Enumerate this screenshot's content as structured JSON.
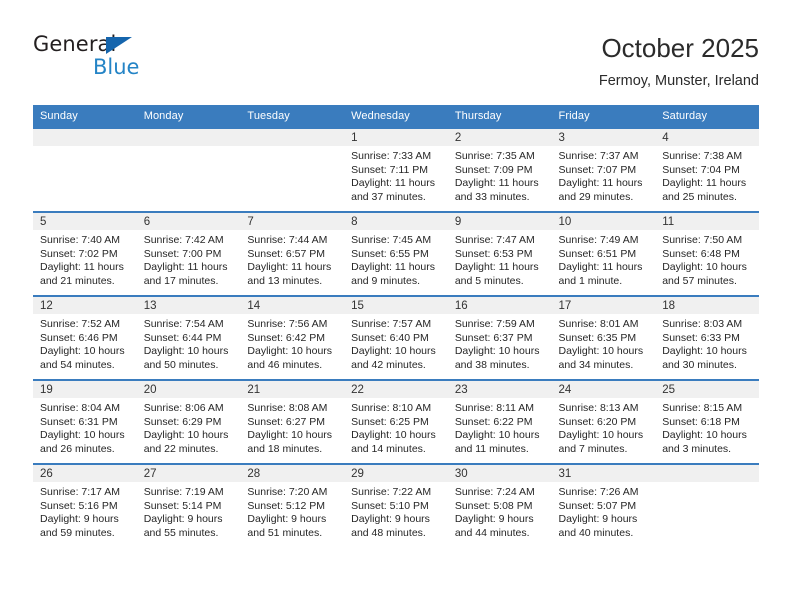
{
  "brand": {
    "name_part1": "General",
    "name_part2": "Blue",
    "triangle_color": "#1565ad",
    "blue_color": "#2484c6"
  },
  "header": {
    "title": "October 2025",
    "location": "Fermoy, Munster, Ireland"
  },
  "theme": {
    "header_blue": "#3a7cbe",
    "daynum_bg": "#f0f0f0",
    "cell_bg": "#ffffff"
  },
  "weekday_headers": [
    "Sunday",
    "Monday",
    "Tuesday",
    "Wednesday",
    "Thursday",
    "Friday",
    "Saturday"
  ],
  "weeks": [
    [
      {
        "day": "",
        "sunrise": "",
        "sunset": "",
        "daylight1": "",
        "daylight2": ""
      },
      {
        "day": "",
        "sunrise": "",
        "sunset": "",
        "daylight1": "",
        "daylight2": ""
      },
      {
        "day": "",
        "sunrise": "",
        "sunset": "",
        "daylight1": "",
        "daylight2": ""
      },
      {
        "day": "1",
        "sunrise": "Sunrise: 7:33 AM",
        "sunset": "Sunset: 7:11 PM",
        "daylight1": "Daylight: 11 hours",
        "daylight2": "and 37 minutes."
      },
      {
        "day": "2",
        "sunrise": "Sunrise: 7:35 AM",
        "sunset": "Sunset: 7:09 PM",
        "daylight1": "Daylight: 11 hours",
        "daylight2": "and 33 minutes."
      },
      {
        "day": "3",
        "sunrise": "Sunrise: 7:37 AM",
        "sunset": "Sunset: 7:07 PM",
        "daylight1": "Daylight: 11 hours",
        "daylight2": "and 29 minutes."
      },
      {
        "day": "4",
        "sunrise": "Sunrise: 7:38 AM",
        "sunset": "Sunset: 7:04 PM",
        "daylight1": "Daylight: 11 hours",
        "daylight2": "and 25 minutes."
      }
    ],
    [
      {
        "day": "5",
        "sunrise": "Sunrise: 7:40 AM",
        "sunset": "Sunset: 7:02 PM",
        "daylight1": "Daylight: 11 hours",
        "daylight2": "and 21 minutes."
      },
      {
        "day": "6",
        "sunrise": "Sunrise: 7:42 AM",
        "sunset": "Sunset: 7:00 PM",
        "daylight1": "Daylight: 11 hours",
        "daylight2": "and 17 minutes."
      },
      {
        "day": "7",
        "sunrise": "Sunrise: 7:44 AM",
        "sunset": "Sunset: 6:57 PM",
        "daylight1": "Daylight: 11 hours",
        "daylight2": "and 13 minutes."
      },
      {
        "day": "8",
        "sunrise": "Sunrise: 7:45 AM",
        "sunset": "Sunset: 6:55 PM",
        "daylight1": "Daylight: 11 hours",
        "daylight2": "and 9 minutes."
      },
      {
        "day": "9",
        "sunrise": "Sunrise: 7:47 AM",
        "sunset": "Sunset: 6:53 PM",
        "daylight1": "Daylight: 11 hours",
        "daylight2": "and 5 minutes."
      },
      {
        "day": "10",
        "sunrise": "Sunrise: 7:49 AM",
        "sunset": "Sunset: 6:51 PM",
        "daylight1": "Daylight: 11 hours",
        "daylight2": "and 1 minute."
      },
      {
        "day": "11",
        "sunrise": "Sunrise: 7:50 AM",
        "sunset": "Sunset: 6:48 PM",
        "daylight1": "Daylight: 10 hours",
        "daylight2": "and 57 minutes."
      }
    ],
    [
      {
        "day": "12",
        "sunrise": "Sunrise: 7:52 AM",
        "sunset": "Sunset: 6:46 PM",
        "daylight1": "Daylight: 10 hours",
        "daylight2": "and 54 minutes."
      },
      {
        "day": "13",
        "sunrise": "Sunrise: 7:54 AM",
        "sunset": "Sunset: 6:44 PM",
        "daylight1": "Daylight: 10 hours",
        "daylight2": "and 50 minutes."
      },
      {
        "day": "14",
        "sunrise": "Sunrise: 7:56 AM",
        "sunset": "Sunset: 6:42 PM",
        "daylight1": "Daylight: 10 hours",
        "daylight2": "and 46 minutes."
      },
      {
        "day": "15",
        "sunrise": "Sunrise: 7:57 AM",
        "sunset": "Sunset: 6:40 PM",
        "daylight1": "Daylight: 10 hours",
        "daylight2": "and 42 minutes."
      },
      {
        "day": "16",
        "sunrise": "Sunrise: 7:59 AM",
        "sunset": "Sunset: 6:37 PM",
        "daylight1": "Daylight: 10 hours",
        "daylight2": "and 38 minutes."
      },
      {
        "day": "17",
        "sunrise": "Sunrise: 8:01 AM",
        "sunset": "Sunset: 6:35 PM",
        "daylight1": "Daylight: 10 hours",
        "daylight2": "and 34 minutes."
      },
      {
        "day": "18",
        "sunrise": "Sunrise: 8:03 AM",
        "sunset": "Sunset: 6:33 PM",
        "daylight1": "Daylight: 10 hours",
        "daylight2": "and 30 minutes."
      }
    ],
    [
      {
        "day": "19",
        "sunrise": "Sunrise: 8:04 AM",
        "sunset": "Sunset: 6:31 PM",
        "daylight1": "Daylight: 10 hours",
        "daylight2": "and 26 minutes."
      },
      {
        "day": "20",
        "sunrise": "Sunrise: 8:06 AM",
        "sunset": "Sunset: 6:29 PM",
        "daylight1": "Daylight: 10 hours",
        "daylight2": "and 22 minutes."
      },
      {
        "day": "21",
        "sunrise": "Sunrise: 8:08 AM",
        "sunset": "Sunset: 6:27 PM",
        "daylight1": "Daylight: 10 hours",
        "daylight2": "and 18 minutes."
      },
      {
        "day": "22",
        "sunrise": "Sunrise: 8:10 AM",
        "sunset": "Sunset: 6:25 PM",
        "daylight1": "Daylight: 10 hours",
        "daylight2": "and 14 minutes."
      },
      {
        "day": "23",
        "sunrise": "Sunrise: 8:11 AM",
        "sunset": "Sunset: 6:22 PM",
        "daylight1": "Daylight: 10 hours",
        "daylight2": "and 11 minutes."
      },
      {
        "day": "24",
        "sunrise": "Sunrise: 8:13 AM",
        "sunset": "Sunset: 6:20 PM",
        "daylight1": "Daylight: 10 hours",
        "daylight2": "and 7 minutes."
      },
      {
        "day": "25",
        "sunrise": "Sunrise: 8:15 AM",
        "sunset": "Sunset: 6:18 PM",
        "daylight1": "Daylight: 10 hours",
        "daylight2": "and 3 minutes."
      }
    ],
    [
      {
        "day": "26",
        "sunrise": "Sunrise: 7:17 AM",
        "sunset": "Sunset: 5:16 PM",
        "daylight1": "Daylight: 9 hours",
        "daylight2": "and 59 minutes."
      },
      {
        "day": "27",
        "sunrise": "Sunrise: 7:19 AM",
        "sunset": "Sunset: 5:14 PM",
        "daylight1": "Daylight: 9 hours",
        "daylight2": "and 55 minutes."
      },
      {
        "day": "28",
        "sunrise": "Sunrise: 7:20 AM",
        "sunset": "Sunset: 5:12 PM",
        "daylight1": "Daylight: 9 hours",
        "daylight2": "and 51 minutes."
      },
      {
        "day": "29",
        "sunrise": "Sunrise: 7:22 AM",
        "sunset": "Sunset: 5:10 PM",
        "daylight1": "Daylight: 9 hours",
        "daylight2": "and 48 minutes."
      },
      {
        "day": "30",
        "sunrise": "Sunrise: 7:24 AM",
        "sunset": "Sunset: 5:08 PM",
        "daylight1": "Daylight: 9 hours",
        "daylight2": "and 44 minutes."
      },
      {
        "day": "31",
        "sunrise": "Sunrise: 7:26 AM",
        "sunset": "Sunset: 5:07 PM",
        "daylight1": "Daylight: 9 hours",
        "daylight2": "and 40 minutes."
      },
      {
        "day": "",
        "sunrise": "",
        "sunset": "",
        "daylight1": "",
        "daylight2": ""
      }
    ]
  ]
}
